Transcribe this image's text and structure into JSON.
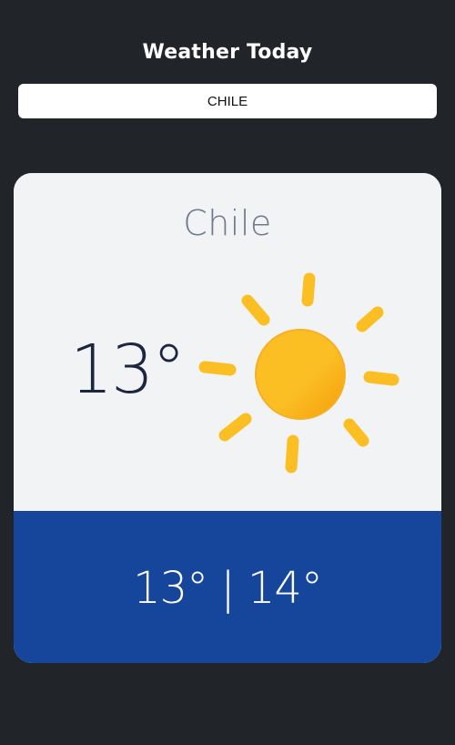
{
  "app": {
    "title": "Weather Today"
  },
  "search": {
    "value": "CHILE"
  },
  "weather": {
    "city": "Chile",
    "current_temp": "13°",
    "range": "13° | 14°",
    "condition_icon": "sun-icon"
  },
  "colors": {
    "page_background": "#212428",
    "card_background": "#f2f3f5",
    "footer_background": "#16469c",
    "sun_ray": "#fbbf24",
    "sun_core": "#fbbf24",
    "sun_core_shade": "#f59e0b"
  }
}
